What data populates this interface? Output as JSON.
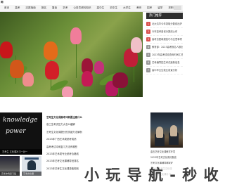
{
  "header": {
    "brand": "网"
  },
  "nav": {
    "items": [
      "首页",
      "高考",
      "志愿指南",
      "报名",
      "复读",
      "艺考",
      "公务员资料知识",
      "高中生",
      "初中生",
      "大学生",
      "考研",
      "招考",
      "留学",
      "求职"
    ]
  },
  "sidebar": {
    "title": "热门推荐",
    "items": [
      "北大清华今年录取分数线出炉",
      "今年高考各省分数线公布",
      "高考志愿填报技巧与注意事项",
      "教育部：2023高考报名人数创新高",
      "2023年高考成绩查询时间汇总",
      "艺考编导招生考试最新信息",
      "高中毕业生就业前景分析"
    ]
  },
  "card1": {
    "chalk_line1": "knowledge",
    "chalk_line2": "power",
    "caption": "艺考生 文化课补习一对一"
  },
  "news": {
    "items": [
      "艺考生文化课高考冲刺要注意什么",
      "高三生考试压力大怎么缓解",
      "艺考生文化课提分的关键方法解析",
      "2023年广西艺术类统考成绩",
      "高考考试冲刺复习方法有哪些",
      "2023年艺术类专业统考合格线",
      "2023年艺考文化课辅导班排名",
      "2023年艺考生文化课录取规则"
    ]
  },
  "card2": {
    "side_items": [
      "金石艺考文化课教学环境",
      "2023年艺考文化课分数线",
      "艺考文化课辅导哪家好",
      "2023年艺考生文化课",
      "高考艺考文化课补习"
    ]
  },
  "thumbs": {
    "a_caption": "高考冲刺复习班",
    "b_caption": "艺考文化课"
  },
  "watermark": "小 玩 导 航 - 秒 收"
}
